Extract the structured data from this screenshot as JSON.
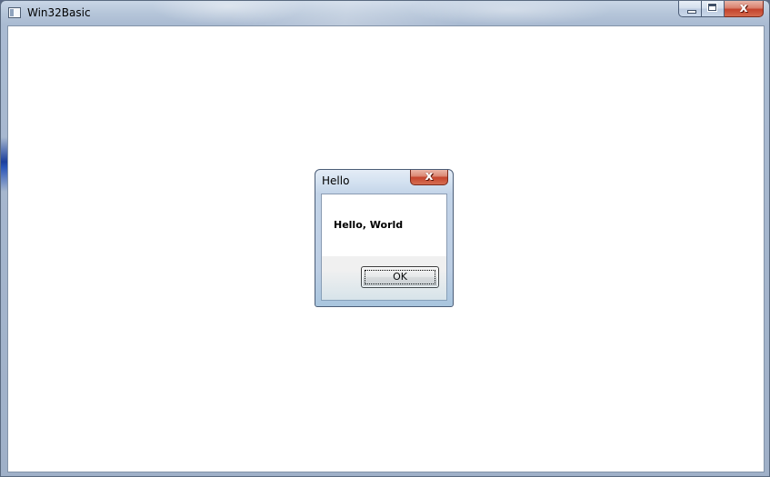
{
  "window": {
    "title": "Win32Basic",
    "icon": "application-icon",
    "controls": {
      "minimize": "minimize-icon",
      "maximize": "maximize-icon",
      "close": "close-icon",
      "close_glyph": "x"
    }
  },
  "dialog": {
    "title": "Hello",
    "message": "Hello, World",
    "ok_label": "OK",
    "close_glyph": "x"
  },
  "colors": {
    "client_background": "#ffffff",
    "close_button_red": "#c4432c",
    "title_bar": "#b5c5d9"
  }
}
